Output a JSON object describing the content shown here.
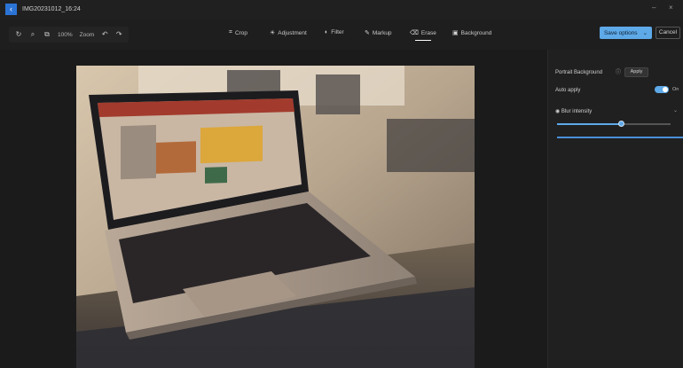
{
  "app": {
    "title": "IMG20231012_16:24",
    "back_icon": "back-arrow-icon",
    "window_controls": [
      "–",
      "×"
    ]
  },
  "toolbar": {
    "left_icons": [
      "rotate-icon",
      "zoom-icon",
      "compare-icon"
    ],
    "left_texts": [
      "100%",
      "Zoom"
    ],
    "right_icons": [
      "undo-icon",
      "redo-icon"
    ],
    "tabs": [
      {
        "label": "Crop",
        "icon": "crop-icon",
        "glyph": "⌗",
        "active": false
      },
      {
        "label": "Adjustment",
        "icon": "adjustment-icon",
        "glyph": "☀",
        "active": false
      },
      {
        "label": "Filter",
        "icon": "filter-icon",
        "glyph": "◐",
        "active": false
      },
      {
        "label": "Markup",
        "icon": "markup-icon",
        "glyph": "✎",
        "active": false
      },
      {
        "label": "Erase",
        "icon": "erase-icon",
        "glyph": "⌫",
        "active": true
      },
      {
        "label": "Background",
        "icon": "background-icon",
        "glyph": "▣",
        "active": false
      }
    ],
    "save_label": "Save options",
    "cancel_label": "Cancel"
  },
  "panel": {
    "portrait_label": "Portrait Background",
    "apply_label": "Apply",
    "auto_label": "Auto apply",
    "toggle_state": "On",
    "blur_label": "Blur intensity",
    "blur_level": 0.56
  },
  "colors": {
    "accent": "#5ea9e8",
    "titlebar_back": "#2b74d6"
  }
}
